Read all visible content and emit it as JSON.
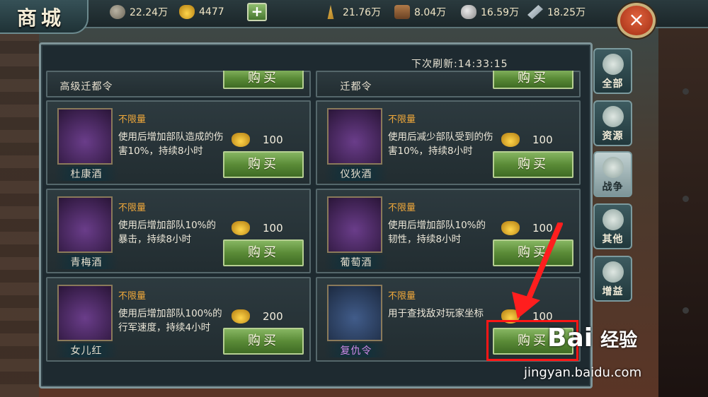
{
  "window": {
    "title": "商城"
  },
  "resources": {
    "copper": "22.24万",
    "ingot": "4477",
    "grain": "21.76万",
    "wood": "8.04万",
    "stone": "16.59万",
    "iron": "18.25万"
  },
  "controls": {
    "add_label": "+",
    "close_label": "×"
  },
  "shop": {
    "refresh_text": "下次刷新:14:33:15",
    "buy_label": "购买",
    "partial_items": [
      {
        "name": "高级迁都令"
      },
      {
        "name": "迁都令"
      }
    ],
    "items": [
      {
        "name": "杜康酒",
        "limit": "不限量",
        "desc": "使用后增加部队造成的伤害10%，持续8小时",
        "price": "100"
      },
      {
        "name": "仪狄酒",
        "limit": "不限量",
        "desc": "使用后减少部队受到的伤害10%，持续8小时",
        "price": "100"
      },
      {
        "name": "青梅酒",
        "limit": "不限量",
        "desc": "使用后增加部队10%的暴击，持续8小时",
        "price": "100"
      },
      {
        "name": "葡萄酒",
        "limit": "不限量",
        "desc": "使用后增加部队10%的韧性，持续8小时",
        "price": "100"
      },
      {
        "name": "女儿红",
        "limit": "不限量",
        "desc": "使用后增加部队100%的行军速度，持续4小时",
        "price": "200"
      },
      {
        "name": "复仇令",
        "limit": "不限量",
        "desc": "用于查找敌对玩家坐标",
        "price": "100"
      }
    ]
  },
  "tabs": [
    {
      "label": "全部"
    },
    {
      "label": "资源"
    },
    {
      "label": "战争"
    },
    {
      "label": "其他"
    },
    {
      "label": "增益"
    }
  ],
  "watermark": {
    "brand": "Bai",
    "brand2": "经验",
    "url": "jingyan.baidu.com"
  }
}
